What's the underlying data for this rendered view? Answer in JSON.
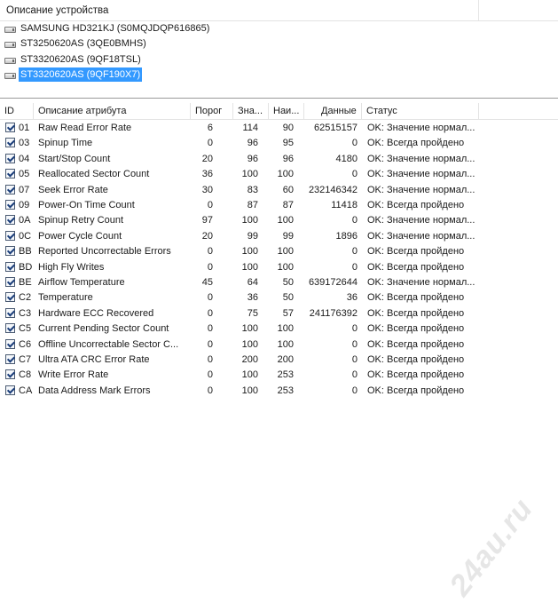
{
  "devices": {
    "header": "Описание устройства",
    "items": [
      {
        "label": "SAMSUNG HD321KJ (S0MQJDQP616865)",
        "selected": false
      },
      {
        "label": "ST3250620AS (3QE0BMHS)",
        "selected": false
      },
      {
        "label": "ST3320620AS (9QF18TSL)",
        "selected": false
      },
      {
        "label": "ST3320620AS (9QF190X7)",
        "selected": true
      }
    ]
  },
  "table": {
    "columns": {
      "id": "ID",
      "name": "Описание атрибута",
      "threshold": "Порог",
      "value": "Зна...",
      "worst": "Наи...",
      "raw": "Данные",
      "status": "Статус"
    },
    "rows": [
      {
        "id": "01",
        "name": "Raw Read Error Rate",
        "threshold": "6",
        "value": "114",
        "worst": "90",
        "raw": "62515157",
        "status": "OK: Значение нормал..."
      },
      {
        "id": "03",
        "name": "Spinup Time",
        "threshold": "0",
        "value": "96",
        "worst": "95",
        "raw": "0",
        "status": "OK: Всегда пройдено"
      },
      {
        "id": "04",
        "name": "Start/Stop Count",
        "threshold": "20",
        "value": "96",
        "worst": "96",
        "raw": "4180",
        "status": "OK: Значение нормал..."
      },
      {
        "id": "05",
        "name": "Reallocated Sector Count",
        "threshold": "36",
        "value": "100",
        "worst": "100",
        "raw": "0",
        "status": "OK: Значение нормал..."
      },
      {
        "id": "07",
        "name": "Seek Error Rate",
        "threshold": "30",
        "value": "83",
        "worst": "60",
        "raw": "232146342",
        "status": "OK: Значение нормал..."
      },
      {
        "id": "09",
        "name": "Power-On Time Count",
        "threshold": "0",
        "value": "87",
        "worst": "87",
        "raw": "11418",
        "status": "OK: Всегда пройдено"
      },
      {
        "id": "0A",
        "name": "Spinup Retry Count",
        "threshold": "97",
        "value": "100",
        "worst": "100",
        "raw": "0",
        "status": "OK: Значение нормал..."
      },
      {
        "id": "0C",
        "name": "Power Cycle Count",
        "threshold": "20",
        "value": "99",
        "worst": "99",
        "raw": "1896",
        "status": "OK: Значение нормал..."
      },
      {
        "id": "BB",
        "name": "Reported Uncorrectable Errors",
        "threshold": "0",
        "value": "100",
        "worst": "100",
        "raw": "0",
        "status": "OK: Всегда пройдено"
      },
      {
        "id": "BD",
        "name": "High Fly Writes",
        "threshold": "0",
        "value": "100",
        "worst": "100",
        "raw": "0",
        "status": "OK: Всегда пройдено"
      },
      {
        "id": "BE",
        "name": "Airflow Temperature",
        "threshold": "45",
        "value": "64",
        "worst": "50",
        "raw": "639172644",
        "status": "OK: Значение нормал..."
      },
      {
        "id": "C2",
        "name": "Temperature",
        "threshold": "0",
        "value": "36",
        "worst": "50",
        "raw": "36",
        "status": "OK: Всегда пройдено"
      },
      {
        "id": "C3",
        "name": "Hardware ECC Recovered",
        "threshold": "0",
        "value": "75",
        "worst": "57",
        "raw": "241176392",
        "status": "OK: Всегда пройдено"
      },
      {
        "id": "C5",
        "name": "Current Pending Sector Count",
        "threshold": "0",
        "value": "100",
        "worst": "100",
        "raw": "0",
        "status": "OK: Всегда пройдено"
      },
      {
        "id": "C6",
        "name": "Offline Uncorrectable Sector C...",
        "threshold": "0",
        "value": "100",
        "worst": "100",
        "raw": "0",
        "status": "OK: Всегда пройдено"
      },
      {
        "id": "C7",
        "name": "Ultra ATA CRC Error Rate",
        "threshold": "0",
        "value": "200",
        "worst": "200",
        "raw": "0",
        "status": "OK: Всегда пройдено"
      },
      {
        "id": "C8",
        "name": "Write Error Rate",
        "threshold": "0",
        "value": "100",
        "worst": "253",
        "raw": "0",
        "status": "OK: Всегда пройдено"
      },
      {
        "id": "CA",
        "name": "Data Address Mark Errors",
        "threshold": "0",
        "value": "100",
        "worst": "253",
        "raw": "0",
        "status": "OK: Всегда пройдено"
      }
    ]
  },
  "watermark": "24au.ru"
}
